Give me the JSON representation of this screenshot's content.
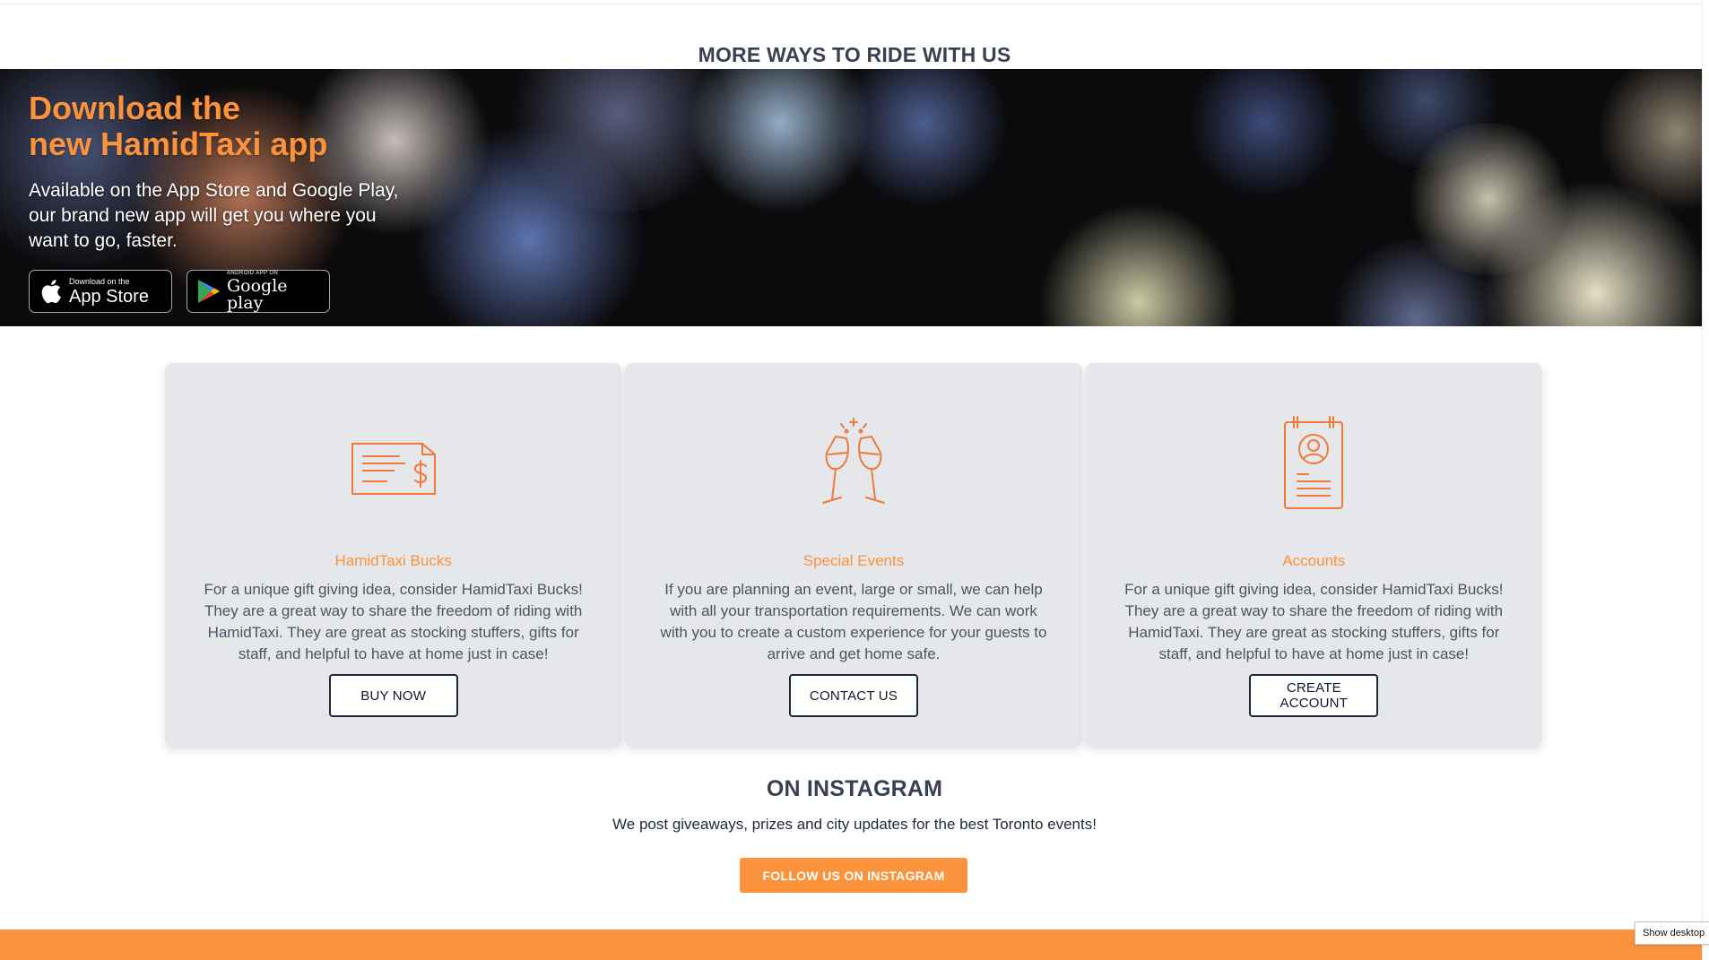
{
  "section_title": "MORE WAYS TO RIDE WITH US",
  "hero": {
    "title_line1": "Download the",
    "title_line2": "new HamidTaxi app",
    "text": "Available on the App Store and Google Play, our brand new app will get you where you want to go, faster.",
    "app_store": {
      "small": "Download on the",
      "big": "App Store",
      "icon": "apple-logo-icon"
    },
    "google_play": {
      "small": "ANDROID APP ON",
      "big": "Google play",
      "icon": "google-play-icon"
    }
  },
  "cards": [
    {
      "icon": "cheque-dollar-icon",
      "title": "HamidTaxi Bucks",
      "text": "For a unique gift giving idea, consider HamidTaxi Bucks! They are a great way to share the freedom of riding with HamidTaxi. They are great as stocking stuffers, gifts for staff, and helpful to have at home just in case!",
      "button": "BUY NOW"
    },
    {
      "icon": "champagne-toast-icon",
      "title": "Special Events",
      "text": "If you are planning an event, large or small, we can help with all your transportation requirements. We can work with you to create a custom experience for your guests to arrive and get home safe.",
      "button": "CONTACT US"
    },
    {
      "icon": "id-badge-icon",
      "title": "Accounts",
      "text": "For a unique gift giving idea, consider HamidTaxi Bucks! They are a great way to share the freedom of riding with HamidTaxi. They are great as stocking stuffers, gifts for staff, and helpful to have at home just in case!",
      "button": "CREATE ACCOUNT"
    }
  ],
  "instagram": {
    "title": "ON INSTAGRAM",
    "text": "We post giveaways, prizes and city updates for the best Toronto events!",
    "button": "FOLLOW US ON INSTAGRAM"
  },
  "tooltip": "Show desktop",
  "colors": {
    "accent": "#fb923c",
    "card_bg": "#e5e7eb",
    "heading": "#374151"
  }
}
